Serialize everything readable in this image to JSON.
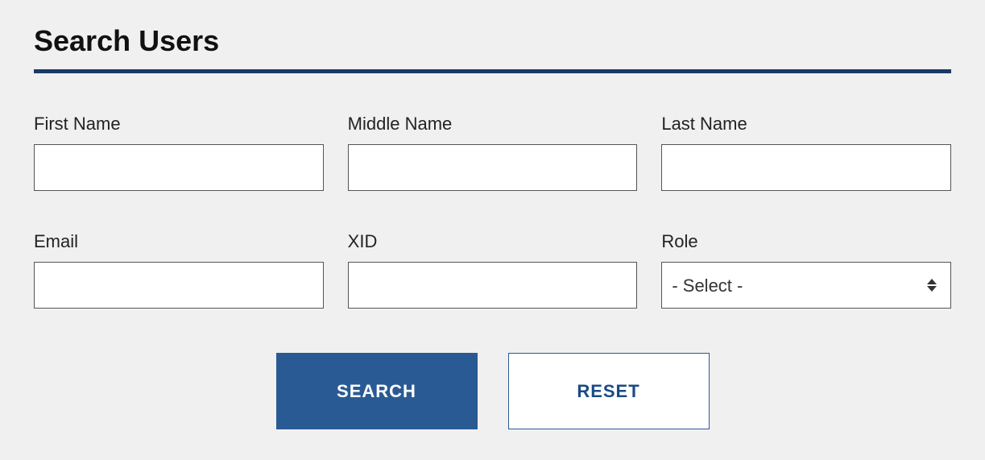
{
  "page": {
    "title": "Search Users"
  },
  "form": {
    "fields": {
      "first_name": {
        "label": "First Name",
        "value": ""
      },
      "middle_name": {
        "label": "Middle Name",
        "value": ""
      },
      "last_name": {
        "label": "Last Name",
        "value": ""
      },
      "email": {
        "label": "Email",
        "value": ""
      },
      "xid": {
        "label": "XID",
        "value": ""
      },
      "role": {
        "label": "Role",
        "selected": "- Select -"
      }
    }
  },
  "buttons": {
    "search": "SEARCH",
    "reset": "RESET"
  }
}
